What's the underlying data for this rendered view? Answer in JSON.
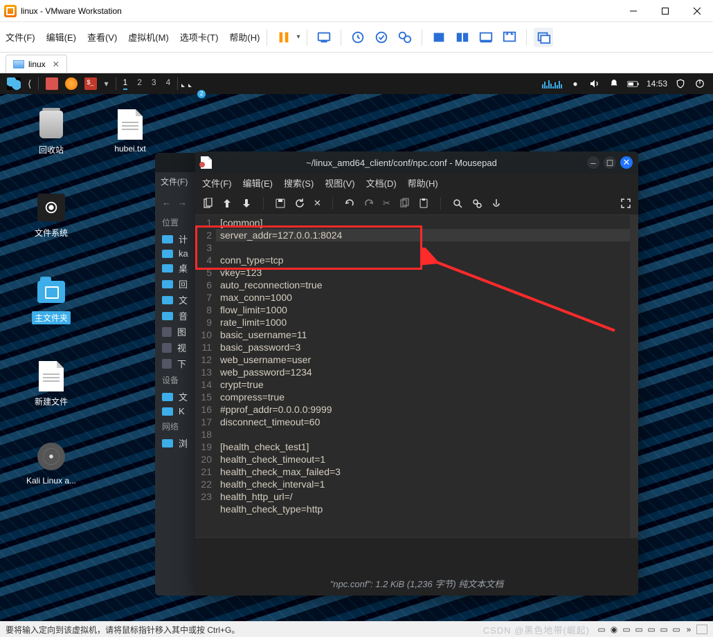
{
  "window": {
    "title": "linux - VMware Workstation"
  },
  "menus": {
    "file": "文件(F)",
    "edit": "编辑(E)",
    "view": "查看(V)",
    "vm": "虚拟机(M)",
    "tabs": "选项卡(T)",
    "help": "帮助(H)"
  },
  "tab": {
    "name": "linux"
  },
  "vm_panel": {
    "workspaces": [
      "1",
      "2",
      "3",
      "4"
    ],
    "badge": "2",
    "clock": "14:53"
  },
  "desktop": {
    "trash": "回收站",
    "txt": "hubei.txt",
    "fsys": "文件系统",
    "home": "主文件夹",
    "newfile": "新建文件",
    "kali": "Kali Linux a..."
  },
  "fm": {
    "menu_file": "文件(F)",
    "sec_pos": "位置",
    "items_pos": [
      "计",
      "ka",
      "桌",
      "回",
      "文",
      "音",
      "图",
      "视",
      "下"
    ],
    "sec_dev": "设备",
    "items_dev": [
      "文",
      "K"
    ],
    "sec_net": "网络",
    "items_net": [
      "浏"
    ]
  },
  "mousepad": {
    "title": "~/linux_amd64_client/conf/npc.conf - Mousepad",
    "menu": {
      "file": "文件(F)",
      "edit": "编辑(E)",
      "search": "搜索(S)",
      "view": "视图(V)",
      "doc": "文档(D)",
      "help": "帮助(H)"
    },
    "lines": [
      "[common]",
      "server_addr=127.0.0.1:8024",
      "conn_type=tcp",
      "vkey=123",
      "auto_reconnection=true",
      "max_conn=1000",
      "flow_limit=1000",
      "rate_limit=1000",
      "basic_username=11",
      "basic_password=3",
      "web_username=user",
      "web_password=1234",
      "crypt=true",
      "compress=true",
      "#pprof_addr=0.0.0.0:9999",
      "disconnect_timeout=60",
      "",
      "[health_check_test1]",
      "health_check_timeout=1",
      "health_check_max_failed=3",
      "health_check_interval=1",
      "health_http_url=/",
      "health_check_type=http"
    ],
    "status": "\"npc.conf\": 1.2 KiB (1,236 字节) 纯文本文档"
  },
  "footer": {
    "hint": "要将输入定向到该虚拟机，请将鼠标指针移入其中或按 Ctrl+G。",
    "watermark": "CSDN @黑色地带(崛起)"
  }
}
